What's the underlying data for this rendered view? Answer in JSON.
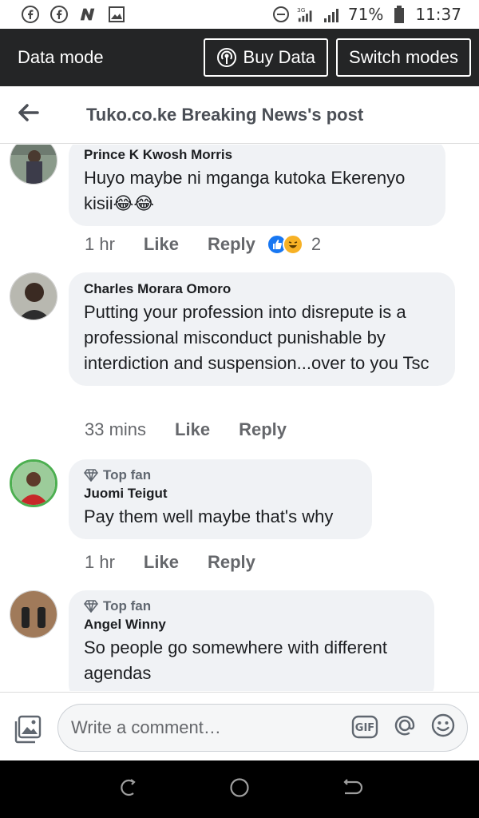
{
  "status_bar": {
    "left_icons": [
      "facebook-icon",
      "facebook-icon",
      "n-app-icon",
      "gallery-icon"
    ],
    "network": "3G",
    "battery_percent": "71%",
    "time": "11:37"
  },
  "data_mode_bar": {
    "label": "Data mode",
    "buy_data_label": "Buy Data",
    "switch_modes_label": "Switch modes"
  },
  "header": {
    "title": "Tuko.co.ke Breaking News's post"
  },
  "comments": [
    {
      "author": "Prince K Kwosh Morris",
      "badge": "",
      "text": "Huyo maybe ni mganga kutoka Ekerenyo kisii",
      "emojis": "😂😂",
      "time": "1 hr",
      "like_label": "Like",
      "reply_label": "Reply",
      "reaction_count": "2"
    },
    {
      "author": "Charles Morara Omoro",
      "badge": "",
      "text": "Putting your profession into disrepute is a professional misconduct punishable by interdiction and suspension...over to you Tsc",
      "time": "33 mins",
      "like_label": "Like",
      "reply_label": "Reply"
    },
    {
      "author": "Juomi Teigut",
      "badge": "Top fan",
      "text": "Pay them well maybe that's why",
      "time": "1 hr",
      "like_label": "Like",
      "reply_label": "Reply"
    },
    {
      "author": "Angel Winny",
      "badge": "Top fan",
      "text": "So people go somewhere with different agendas"
    }
  ],
  "composer": {
    "placeholder": "Write a comment…",
    "gif_label": "GIF"
  },
  "colors": {
    "data_bar_bg": "#242526",
    "bubble_bg": "#f0f2f5",
    "like_blue": "#1877f2",
    "haha_yellow": "#f7b125"
  }
}
